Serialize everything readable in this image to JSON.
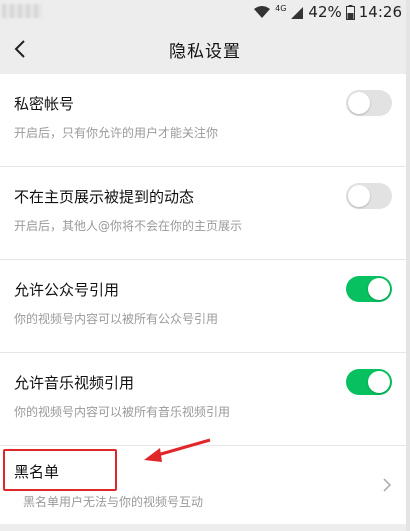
{
  "status_bar": {
    "network": "4G",
    "battery": "42%",
    "time": "14:26"
  },
  "header": {
    "title": "隐私设置"
  },
  "settings": [
    {
      "title": "私密帐号",
      "desc": "开启后，只有你允许的用户才能关注你",
      "toggle": "off"
    },
    {
      "title": "不在主页展示被提到的动态",
      "desc": "开启后，其他人@你将不会在你的主页展示",
      "toggle": "off"
    },
    {
      "title": "允许公众号引用",
      "desc": "你的视频号内容可以被所有公众号引用",
      "toggle": "on"
    },
    {
      "title": "允许音乐视频引用",
      "desc": "你的视频号内容可以被所有音乐视频引用",
      "toggle": "on"
    }
  ],
  "blacklist": {
    "title": "黑名单",
    "desc": "黑名单用户无法与你的视频号互动"
  },
  "colors": {
    "toggle_on": "#07c160",
    "toggle_off": "#e2e2e2",
    "highlight": "#e0272a",
    "background": "#ededed"
  },
  "icons": {
    "back": "chevron-left-icon",
    "row_arrow": "chevron-right-icon"
  }
}
